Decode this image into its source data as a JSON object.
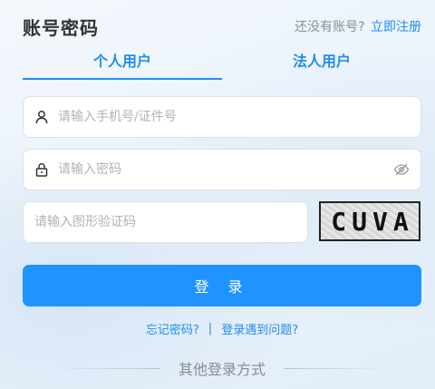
{
  "header": {
    "title": "账号密码",
    "no_account_text": "还没有账号?",
    "register_link": "立即注册"
  },
  "tabs": [
    {
      "label": "个人用户",
      "active": true
    },
    {
      "label": "法人用户",
      "active": false
    }
  ],
  "form": {
    "phone": {
      "placeholder": "请输入手机号/证件号",
      "value": ""
    },
    "password": {
      "placeholder": "请输入密码",
      "value": ""
    },
    "captcha": {
      "placeholder": "请输入图形验证码",
      "value": "",
      "image_text": "CUVA"
    }
  },
  "login_button": "登 录",
  "help": {
    "forgot": "忘记密码?",
    "separator": "|",
    "problem": "登录遇到问题?"
  },
  "other_login": "其他登录方式",
  "colors": {
    "accent": "#1f8ef1",
    "button": "#1f93ff"
  },
  "icons": {
    "user": "user-icon",
    "lock": "lock-icon",
    "eye": "eye-off-icon"
  }
}
